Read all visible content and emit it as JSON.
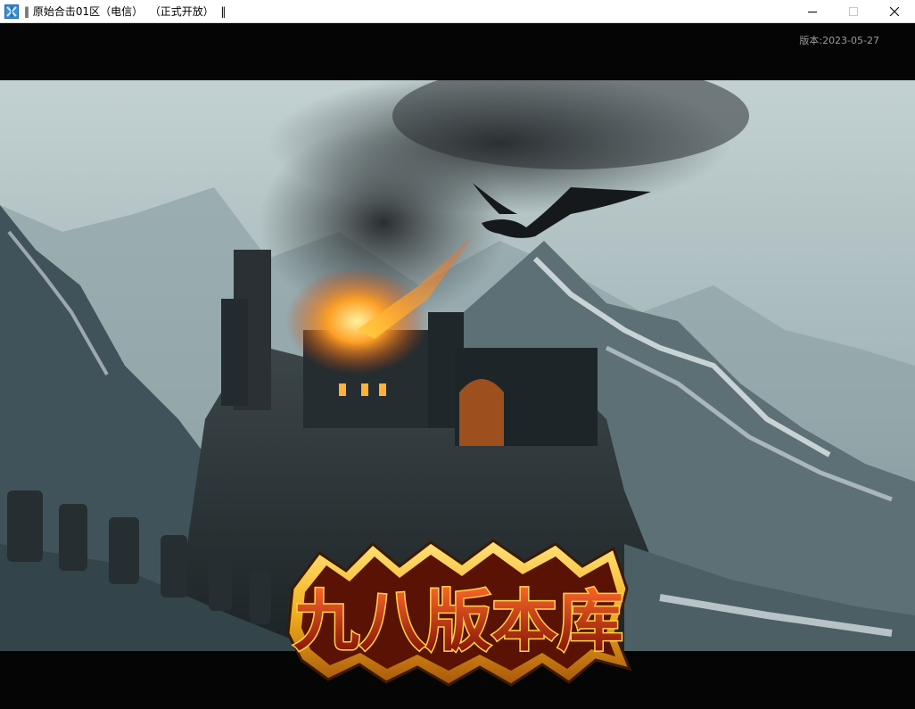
{
  "window": {
    "title": "‖ 原始合击01区（电信）  （正式开放）  ‖",
    "controls": {
      "minimize_icon": "minimize-icon",
      "maximize_icon": "maximize-icon",
      "close_icon": "close-icon"
    }
  },
  "launcher": {
    "version_text": "版本:2023-05-27",
    "logo_text": "九八版本库"
  },
  "colors": {
    "titlebar_bg": "#ffffff",
    "client_bg": "#050505",
    "sky": "#b9c8c9",
    "fire": "#ff8a1c",
    "logo_gold": "#f2b01e",
    "logo_red": "#b81d0e"
  }
}
